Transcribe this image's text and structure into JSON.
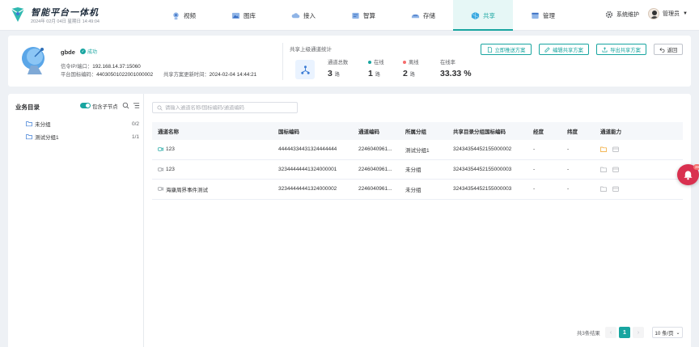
{
  "app": {
    "title": "智能平台一体机",
    "datetime": "2024年 02月 04日 星期日 14:49:04"
  },
  "nav": [
    {
      "label": "视频",
      "icon": "camera-icon"
    },
    {
      "label": "图库",
      "icon": "gallery-icon"
    },
    {
      "label": "接入",
      "icon": "cloud-icon"
    },
    {
      "label": "智算",
      "icon": "compute-icon"
    },
    {
      "label": "存储",
      "icon": "storage-icon"
    },
    {
      "label": "共享",
      "icon": "share-icon",
      "active": true
    },
    {
      "label": "管理",
      "icon": "manage-icon"
    }
  ],
  "header_right": {
    "system_label": "系统维护",
    "user_label": "管理员"
  },
  "device": {
    "name": "gbde",
    "status": "成功",
    "signal_label": "信令IP/端口：",
    "signal_value": "192.168.14.37:15060",
    "gb_label": "平台国标编码：",
    "gb_value": "44030501022001000002",
    "update_label": "共享方案更新时间：",
    "update_value": "2024-02-04 14:44:21"
  },
  "stats": {
    "title": "共享上级通道统计",
    "total_label": "通道总数",
    "total_value": "3",
    "online_label": "在线",
    "online_value": "1",
    "offline_label": "离线",
    "offline_value": "2",
    "rate_label": "在线率",
    "rate_value": "33.33 %",
    "unit": "路"
  },
  "actions": {
    "push": "立即推送方案",
    "edit": "编辑共享方案",
    "export": "导出共享方案",
    "back": "返回"
  },
  "sidebar": {
    "title": "业务目录",
    "toggle_label": "包含子节点",
    "toggle_on": true,
    "items": [
      {
        "label": "未分组",
        "count": "0/2"
      },
      {
        "label": "测试分组1",
        "count": "1/1"
      }
    ]
  },
  "search": {
    "placeholder": "请输入通道名称/国标编码/通道编码"
  },
  "table": {
    "headers": [
      "通道名称",
      "国标编码",
      "通道编码",
      "所属分组",
      "共享目录分组国标编码",
      "经度",
      "纬度",
      "通道能力"
    ],
    "rows": [
      {
        "name": "123",
        "gb": "44444334431324444444",
        "code": "2246040961...",
        "group": "测试分组1",
        "dir": "32434354452155000002",
        "lng": "-",
        "lat": "-",
        "online": true
      },
      {
        "name": "123",
        "gb": "32344444441324000001",
        "code": "2246040961...",
        "group": "未分组",
        "dir": "32434354452155000003",
        "lng": "-",
        "lat": "-",
        "online": false
      },
      {
        "name": "海康周界事件测试",
        "gb": "32344444441324000002",
        "code": "2246040961...",
        "group": "未分组",
        "dir": "32434354452155000003",
        "lng": "-",
        "lat": "-",
        "online": false
      }
    ]
  },
  "pagination": {
    "total": "共3条结果",
    "page": "1",
    "prev": "‹",
    "next": "›",
    "page_size": "10 条/页"
  },
  "notification_badge": "39",
  "colors": {
    "accent": "#18a5a0",
    "danger": "#f56c6c",
    "bell": "#d9304f"
  }
}
